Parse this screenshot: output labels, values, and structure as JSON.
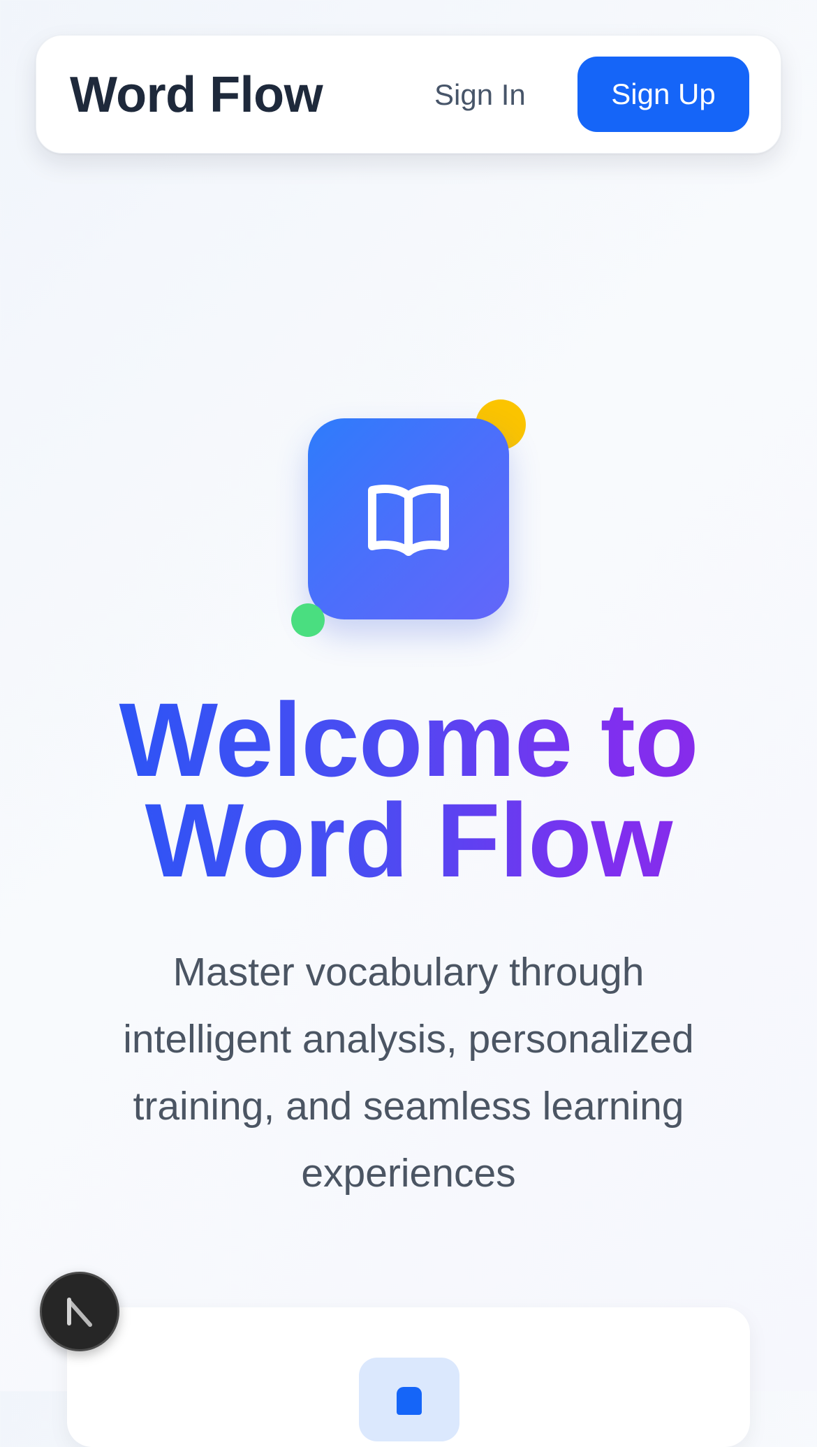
{
  "header": {
    "brand": "Word Flow",
    "sign_in_label": "Sign In",
    "sign_up_label": "Sign Up"
  },
  "hero": {
    "logo_icon": "open-book-icon",
    "title": "Welcome to Word Flow",
    "subtitle": "Master vocabulary through intelligent analysis, personalized training, and seamless learning experiences"
  },
  "feature_card": {
    "icon": "document-icon"
  },
  "dev_badge": {
    "icon": "next-logo-icon"
  },
  "colors": {
    "primary": "#1565f8",
    "heading_dark": "#1e293b",
    "gradient_start": "#2856f6",
    "gradient_end": "#8b2ae8",
    "accent_yellow": "#fbc400",
    "accent_green": "#4ade80",
    "body_text": "#4b5563"
  }
}
